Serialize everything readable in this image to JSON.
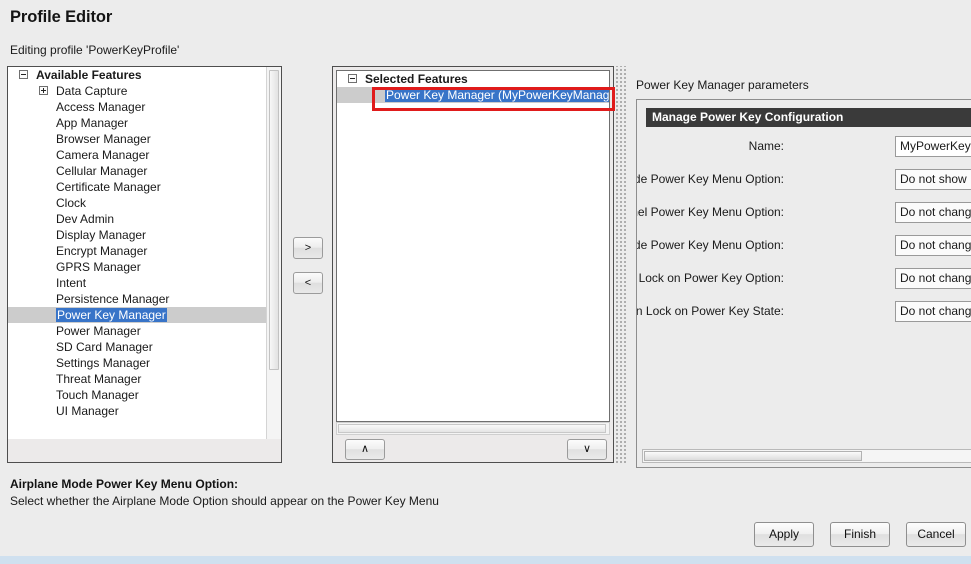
{
  "header": {
    "title": "Profile Editor",
    "subtitle": "Editing profile 'PowerKeyProfile'"
  },
  "available": {
    "root_label": "Available Features",
    "items": [
      {
        "label": "Data Capture",
        "toggle": "plus",
        "selected": false
      },
      {
        "label": "Access Manager",
        "toggle": "none",
        "selected": false
      },
      {
        "label": "App Manager",
        "toggle": "none",
        "selected": false
      },
      {
        "label": "Browser Manager",
        "toggle": "none",
        "selected": false
      },
      {
        "label": "Camera Manager",
        "toggle": "none",
        "selected": false
      },
      {
        "label": "Cellular Manager",
        "toggle": "none",
        "selected": false
      },
      {
        "label": "Certificate Manager",
        "toggle": "none",
        "selected": false
      },
      {
        "label": "Clock",
        "toggle": "none",
        "selected": false
      },
      {
        "label": "Dev Admin",
        "toggle": "none",
        "selected": false
      },
      {
        "label": "Display Manager",
        "toggle": "none",
        "selected": false
      },
      {
        "label": "Encrypt Manager",
        "toggle": "none",
        "selected": false
      },
      {
        "label": "GPRS Manager",
        "toggle": "none",
        "selected": false
      },
      {
        "label": "Intent",
        "toggle": "none",
        "selected": false
      },
      {
        "label": "Persistence Manager",
        "toggle": "none",
        "selected": false
      },
      {
        "label": "Power Key Manager",
        "toggle": "none",
        "selected": true
      },
      {
        "label": "Power Manager",
        "toggle": "none",
        "selected": false
      },
      {
        "label": "SD Card Manager",
        "toggle": "none",
        "selected": false
      },
      {
        "label": "Settings Manager",
        "toggle": "none",
        "selected": false
      },
      {
        "label": "Threat Manager",
        "toggle": "none",
        "selected": false
      },
      {
        "label": "Touch Manager",
        "toggle": "none",
        "selected": false
      },
      {
        "label": "UI Manager",
        "toggle": "none",
        "selected": false
      }
    ]
  },
  "transfer": {
    "add_label": ">",
    "remove_label": "<"
  },
  "selected": {
    "root_label": "Selected Features",
    "items": [
      {
        "label": "Power Key Manager (MyPowerKeyManager)",
        "selected": true
      }
    ],
    "move_up_label": "∧",
    "move_down_label": "∨"
  },
  "annotation": {
    "color": "#e01b1b",
    "target": "Power Key Manager (MyPowerKeyManager)"
  },
  "parameters": {
    "panel_label": "Power Key Manager parameters",
    "section_header": "Manage Power Key Configuration",
    "rows": [
      {
        "label": "Name:",
        "value": "MyPowerKeyManager",
        "kind": "text"
      },
      {
        "label": "Airplane Mode Power Key Menu Option:",
        "value": "Do not show",
        "kind": "combo"
      },
      {
        "label": "Touch Panel Power Key Menu Option:",
        "value": "Do not change",
        "kind": "combo"
      },
      {
        "label": "Safe Mode Power Key Menu Option:",
        "value": "Do not change",
        "kind": "combo"
      },
      {
        "label": "Automatic Screen Lock on Power Key Option:",
        "value": "Do not change",
        "kind": "combo"
      },
      {
        "label": "Automatic Screen Lock on Power Key State:",
        "value": "Do not change",
        "kind": "combo"
      }
    ]
  },
  "help": {
    "title": "Airplane Mode Power Key Menu Option:",
    "text": "Select whether the Airplane Mode Option should appear on the Power Key Menu"
  },
  "footer": {
    "apply_label": "Apply",
    "finish_label": "Finish",
    "cancel_label": "Cancel"
  }
}
